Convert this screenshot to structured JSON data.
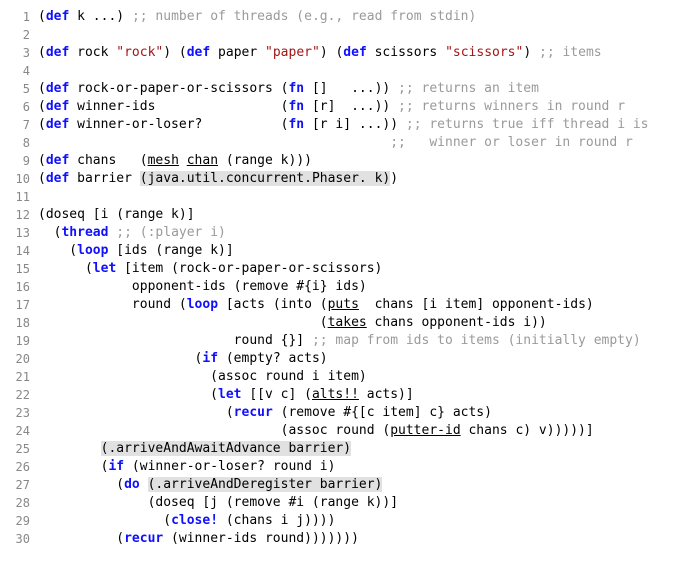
{
  "code": {
    "lines": [
      {
        "n": 1,
        "tokens": [
          {
            "t": "(",
            "c": ""
          },
          {
            "t": "def",
            "c": "kw"
          },
          {
            "t": " k ...) ",
            "c": ""
          },
          {
            "t": ";; number of threads (e.g., read from stdin)",
            "c": "cm"
          }
        ]
      },
      {
        "n": 2,
        "tokens": []
      },
      {
        "n": 3,
        "tokens": [
          {
            "t": "(",
            "c": ""
          },
          {
            "t": "def",
            "c": "kw"
          },
          {
            "t": " rock ",
            "c": ""
          },
          {
            "t": "\"rock\"",
            "c": "str"
          },
          {
            "t": ") (",
            "c": ""
          },
          {
            "t": "def",
            "c": "kw"
          },
          {
            "t": " paper ",
            "c": ""
          },
          {
            "t": "\"paper\"",
            "c": "str"
          },
          {
            "t": ") (",
            "c": ""
          },
          {
            "t": "def",
            "c": "kw"
          },
          {
            "t": " scissors ",
            "c": ""
          },
          {
            "t": "\"scissors\"",
            "c": "str"
          },
          {
            "t": ") ",
            "c": ""
          },
          {
            "t": ";; items",
            "c": "cm"
          }
        ]
      },
      {
        "n": 4,
        "tokens": []
      },
      {
        "n": 5,
        "tokens": [
          {
            "t": "(",
            "c": ""
          },
          {
            "t": "def",
            "c": "kw"
          },
          {
            "t": " rock-or-paper-or-scissors (",
            "c": ""
          },
          {
            "t": "fn",
            "c": "kw"
          },
          {
            "t": " []   ...)) ",
            "c": ""
          },
          {
            "t": ";; returns an item",
            "c": "cm"
          }
        ]
      },
      {
        "n": 6,
        "tokens": [
          {
            "t": "(",
            "c": ""
          },
          {
            "t": "def",
            "c": "kw"
          },
          {
            "t": " winner-ids                (",
            "c": ""
          },
          {
            "t": "fn",
            "c": "kw"
          },
          {
            "t": " [r]  ...)) ",
            "c": ""
          },
          {
            "t": ";; returns winners in round r",
            "c": "cm"
          }
        ]
      },
      {
        "n": 7,
        "tokens": [
          {
            "t": "(",
            "c": ""
          },
          {
            "t": "def",
            "c": "kw"
          },
          {
            "t": " winner-or-loser?          (",
            "c": ""
          },
          {
            "t": "fn",
            "c": "kw"
          },
          {
            "t": " [r i] ...)) ",
            "c": ""
          },
          {
            "t": ";; returns true iff thread i is",
            "c": "cm"
          }
        ]
      },
      {
        "n": 8,
        "tokens": [
          {
            "t": "                                             ",
            "c": ""
          },
          {
            "t": ";;   winner or loser in round r",
            "c": "cm"
          }
        ]
      },
      {
        "n": 9,
        "tokens": [
          {
            "t": "(",
            "c": ""
          },
          {
            "t": "def",
            "c": "kw"
          },
          {
            "t": " chans   (",
            "c": ""
          },
          {
            "t": "mesh",
            "c": "ul"
          },
          {
            "t": " ",
            "c": ""
          },
          {
            "t": "chan",
            "c": "ul"
          },
          {
            "t": " (range k)))",
            "c": ""
          }
        ]
      },
      {
        "n": 10,
        "tokens": [
          {
            "t": "(",
            "c": ""
          },
          {
            "t": "def",
            "c": "kw"
          },
          {
            "t": " barrier ",
            "c": ""
          },
          {
            "t": "(java.util.concurrent.Phaser. k)",
            "c": "hl"
          },
          {
            "t": ")",
            "c": ""
          }
        ]
      },
      {
        "n": 11,
        "tokens": []
      },
      {
        "n": 12,
        "tokens": [
          {
            "t": "(doseq [i (range k)]",
            "c": ""
          }
        ]
      },
      {
        "n": 13,
        "tokens": [
          {
            "t": "  (",
            "c": ""
          },
          {
            "t": "thread",
            "c": "kw"
          },
          {
            "t": " ",
            "c": ""
          },
          {
            "t": ";; (:player i)",
            "c": "cm"
          }
        ]
      },
      {
        "n": 14,
        "tokens": [
          {
            "t": "    (",
            "c": ""
          },
          {
            "t": "loop",
            "c": "kw"
          },
          {
            "t": " [ids (range k)]",
            "c": ""
          }
        ]
      },
      {
        "n": 15,
        "tokens": [
          {
            "t": "      (",
            "c": ""
          },
          {
            "t": "let",
            "c": "kw"
          },
          {
            "t": " [item (rock-or-paper-or-scissors)",
            "c": ""
          }
        ]
      },
      {
        "n": 16,
        "tokens": [
          {
            "t": "            opponent-ids (remove #{i} ids)",
            "c": ""
          }
        ]
      },
      {
        "n": 17,
        "tokens": [
          {
            "t": "            round (",
            "c": ""
          },
          {
            "t": "loop",
            "c": "kw"
          },
          {
            "t": " [acts (into (",
            "c": ""
          },
          {
            "t": "puts",
            "c": "ul"
          },
          {
            "t": "  chans [i item] opponent-ids)",
            "c": ""
          }
        ]
      },
      {
        "n": 18,
        "tokens": [
          {
            "t": "                                    (",
            "c": ""
          },
          {
            "t": "takes",
            "c": "ul"
          },
          {
            "t": " chans opponent-ids i))",
            "c": ""
          }
        ]
      },
      {
        "n": 19,
        "tokens": [
          {
            "t": "                         round {}] ",
            "c": ""
          },
          {
            "t": ";; map from ids to items (initially empty)",
            "c": "cm"
          }
        ]
      },
      {
        "n": 20,
        "tokens": [
          {
            "t": "                    (",
            "c": ""
          },
          {
            "t": "if",
            "c": "kw"
          },
          {
            "t": " (empty? acts)",
            "c": ""
          }
        ]
      },
      {
        "n": 21,
        "tokens": [
          {
            "t": "                      (assoc round i item)",
            "c": ""
          }
        ]
      },
      {
        "n": 22,
        "tokens": [
          {
            "t": "                      (",
            "c": ""
          },
          {
            "t": "let",
            "c": "kw"
          },
          {
            "t": " [[v c] (",
            "c": ""
          },
          {
            "t": "alts!!",
            "c": "ul"
          },
          {
            "t": " acts)]",
            "c": ""
          }
        ]
      },
      {
        "n": 23,
        "tokens": [
          {
            "t": "                        (",
            "c": ""
          },
          {
            "t": "recur",
            "c": "kw"
          },
          {
            "t": " (remove #{[c item] c} acts)",
            "c": ""
          }
        ]
      },
      {
        "n": 24,
        "tokens": [
          {
            "t": "                               (assoc round (",
            "c": ""
          },
          {
            "t": "putter-id",
            "c": "ul"
          },
          {
            "t": " chans c) v)))))]",
            "c": ""
          }
        ]
      },
      {
        "n": 25,
        "tokens": [
          {
            "t": "        ",
            "c": ""
          },
          {
            "t": "(.arriveAndAwaitAdvance barrier)",
            "c": "hl"
          }
        ]
      },
      {
        "n": 26,
        "tokens": [
          {
            "t": "        (",
            "c": ""
          },
          {
            "t": "if",
            "c": "kw"
          },
          {
            "t": " (winner-or-loser? round i)",
            "c": ""
          }
        ]
      },
      {
        "n": 27,
        "tokens": [
          {
            "t": "          (",
            "c": ""
          },
          {
            "t": "do",
            "c": "kw"
          },
          {
            "t": " ",
            "c": ""
          },
          {
            "t": "(.arriveAndDeregister barrier)",
            "c": "hl"
          }
        ]
      },
      {
        "n": 28,
        "tokens": [
          {
            "t": "              (doseq [j (remove #i (range k))]",
            "c": ""
          }
        ]
      },
      {
        "n": 29,
        "tokens": [
          {
            "t": "                (",
            "c": ""
          },
          {
            "t": "close!",
            "c": "kw"
          },
          {
            "t": " (chans i j))))",
            "c": ""
          }
        ]
      },
      {
        "n": 30,
        "tokens": [
          {
            "t": "          (",
            "c": ""
          },
          {
            "t": "recur",
            "c": "kw"
          },
          {
            "t": " (winner-ids round)))))))",
            "c": ""
          }
        ]
      }
    ]
  }
}
